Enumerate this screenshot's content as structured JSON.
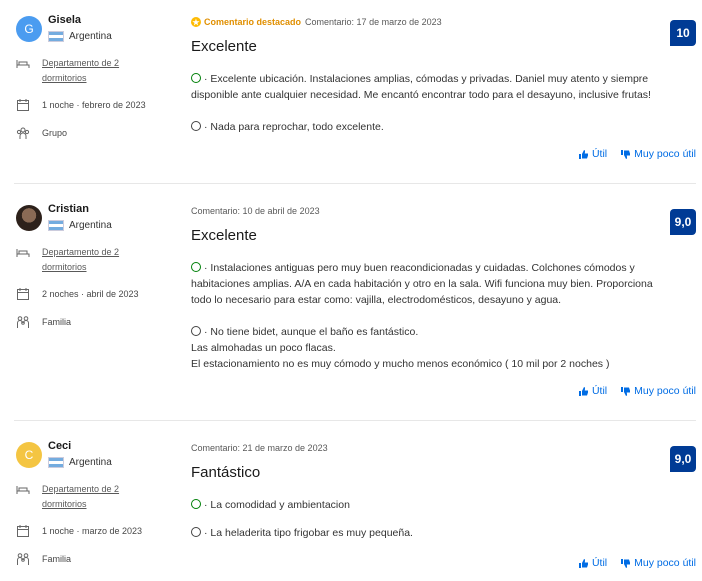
{
  "reviews": [
    {
      "name": "Gisela",
      "avatar_letter": "G",
      "avatar_color": "#4b9cf0",
      "country": "Argentina",
      "room": [
        "Departamento de 2",
        "dormitorios"
      ],
      "stay": "1 noche · febrero de 2023",
      "traveler": "Grupo",
      "featured": "Comentario destacado",
      "date": "Comentario: 17 de marzo de 2023",
      "title": "Excelente",
      "score": "10",
      "positive": "· Excelente ubicación. Instalaciones amplias, cómodas y privadas. Daniel muy atento y siempre disponible ante cualquier necesidad. Me encantó encontrar todo para el desayuno, inclusive frutas!",
      "negative": "· Nada para reprochar, todo excelente.",
      "helpful": "Útil",
      "not_helpful": "Muy poco útil"
    },
    {
      "name": "Cristian",
      "avatar_letter": "",
      "avatar_color": "#3a2a22",
      "country": "Argentina",
      "room": [
        "Departamento de 2",
        "dormitorios"
      ],
      "stay": "2 noches · abril de 2023",
      "traveler": "Familia",
      "featured": "",
      "date": "Comentario: 10 de abril de 2023",
      "title": "Excelente",
      "score": "9,0",
      "positive": "· Instalaciones antiguas pero muy buen reacondicionadas y cuidadas. Colchones cómodos y habitaciones amplias. A/A en cada habitación y otro en la sala. Wifi funciona muy bien. Proporciona todo lo necesario para estar como: vajilla, electrodomésticos, desayuno y agua.",
      "negative": "· No tiene bidet, aunque el baño es fantástico.",
      "negative_extra": [
        "Las almohadas un poco flacas.",
        "El estacionamiento no es muy cómodo y mucho menos económico ( 10 mil por 2 noches )"
      ],
      "helpful": "Útil",
      "not_helpful": "Muy poco útil"
    },
    {
      "name": "Ceci",
      "avatar_letter": "C",
      "avatar_color": "#f4c542",
      "country": "Argentina",
      "room": [
        "Departamento de 2",
        "dormitorios"
      ],
      "stay": "1 noche · marzo de 2023",
      "traveler": "Familia",
      "featured": "",
      "date": "Comentario: 21 de marzo de 2023",
      "title": "Fantástico",
      "score": "9,0",
      "positive": "· La comodidad y ambientacion",
      "negative": "· La heladerita tipo frigobar es muy pequeña.",
      "helpful": "Útil",
      "not_helpful": "Muy poco útil"
    }
  ],
  "colors": {
    "brand_blue": "#003b95",
    "link_blue": "#006ce4",
    "positive_green": "#008009",
    "featured_orange": "#e08f00"
  }
}
